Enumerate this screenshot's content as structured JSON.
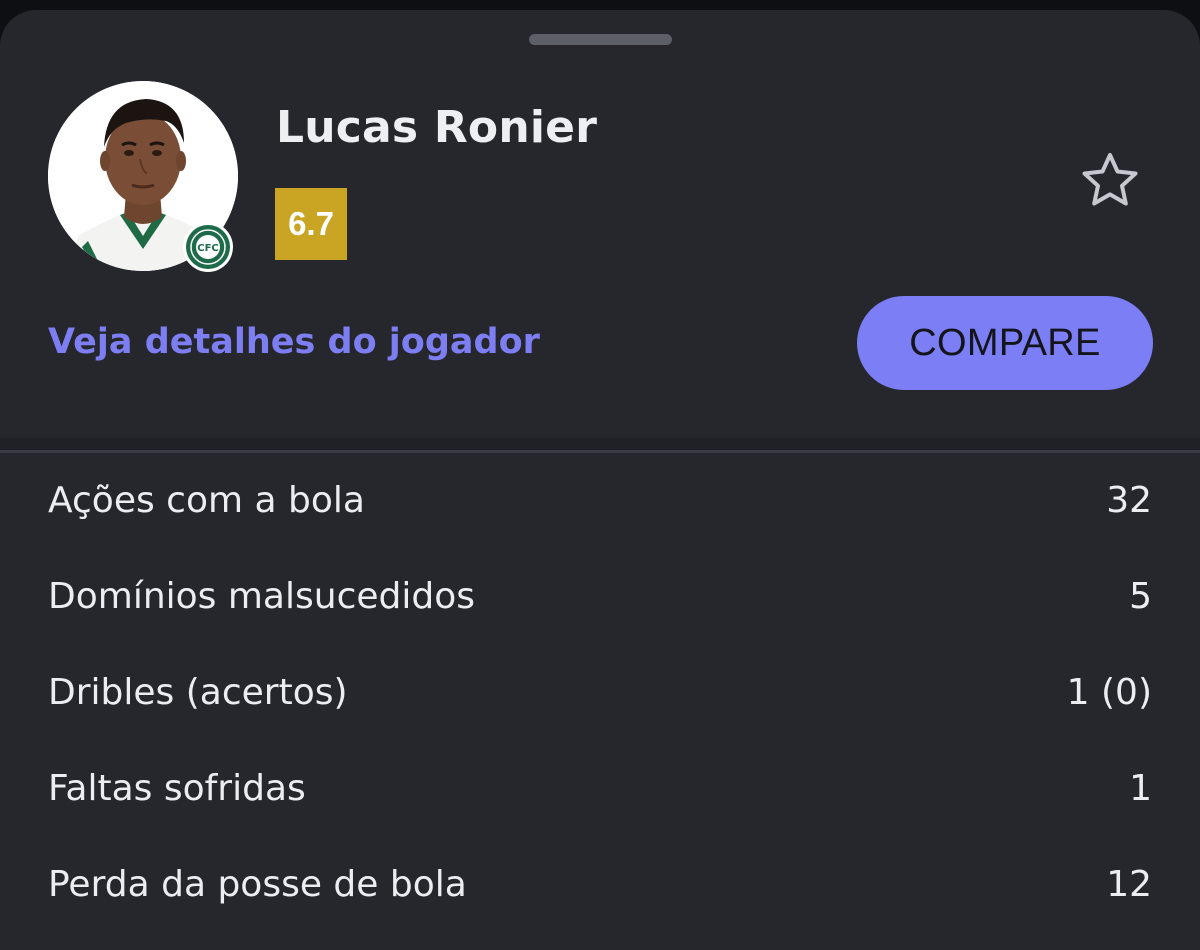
{
  "player": {
    "name": "Lucas Ronier",
    "rating": "6.7",
    "club_badge_text": "CFC"
  },
  "actions": {
    "details_link": "Veja detalhes do jogador",
    "compare_label": "COMPARE"
  },
  "stats": [
    {
      "label": "Ações com a bola",
      "value": "32"
    },
    {
      "label": "Domínios malsucedidos",
      "value": "5"
    },
    {
      "label": "Dribles (acertos)",
      "value": "1 (0)"
    },
    {
      "label": "Faltas sofridas",
      "value": "1"
    },
    {
      "label": "Perda da posse de bola",
      "value": "12"
    }
  ],
  "icons": {
    "favorite": "star-outline-icon",
    "club": "club-crest-icon"
  },
  "colors": {
    "background": "#25272d",
    "accent": "#7b7ef5",
    "link": "#7d7ef2",
    "rating": "#c9a523",
    "club_green": "#1e6b4a"
  }
}
